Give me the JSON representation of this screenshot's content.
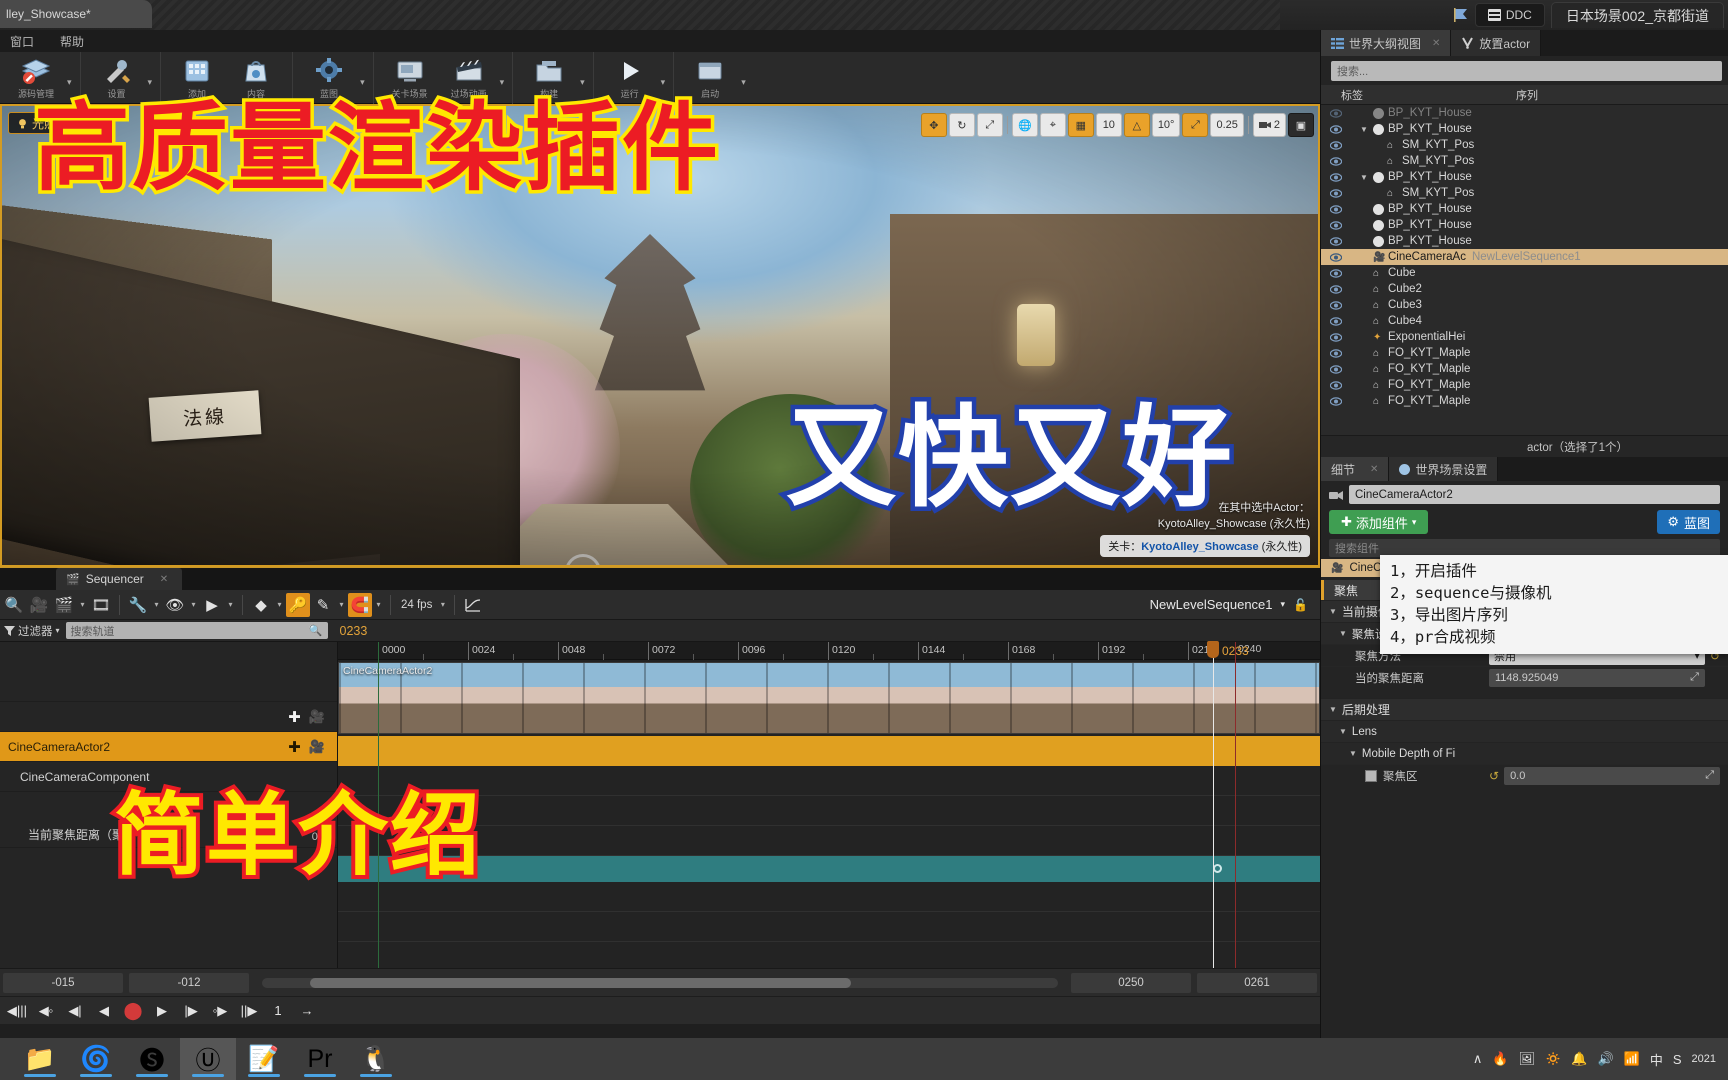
{
  "titlebar": {
    "project_tab": "lley_Showcase*",
    "ddc_label": "DDC",
    "scene_tab": "日本场景002_京都街道"
  },
  "menubar": {
    "items": [
      "窗口",
      "帮助"
    ]
  },
  "toolbar": {
    "items": [
      {
        "label": "源码管理",
        "icon": "source-control-icon",
        "glyph": "📚",
        "caret": true
      },
      {
        "label": "设置",
        "icon": "settings-wrench-icon",
        "glyph": "🛠",
        "caret": true
      },
      {
        "label": "添加",
        "icon": "add-content-icon",
        "glyph": "🗂",
        "caret": false
      },
      {
        "label": "内容",
        "icon": "content-browser-icon",
        "glyph": "🛍",
        "caret": false
      },
      {
        "label": "蓝图",
        "icon": "blueprint-icon",
        "glyph": "🎛",
        "caret": true
      },
      {
        "label": "关卡场景",
        "icon": "cinematics-icon",
        "glyph": "🖥",
        "caret": false
      },
      {
        "label": "过场动画",
        "icon": "sequencer-clapper-icon",
        "glyph": "🎬",
        "caret": true
      },
      {
        "label": "构建",
        "icon": "build-icon",
        "glyph": "📁",
        "caret": true
      },
      {
        "label": "运行",
        "icon": "play-icon",
        "glyph": "▶",
        "caret": true
      },
      {
        "label": "启动",
        "icon": "launch-icon",
        "glyph": "🗔",
        "caret": true
      }
    ]
  },
  "viewport": {
    "realtime_badge": "光照",
    "sign_text": "法線",
    "sign2_text": "法線",
    "toolbar": [
      {
        "name": "select-mode",
        "label": "✥",
        "state": "selected"
      },
      {
        "name": "rotate-mode",
        "label": "↻",
        "state": "normal"
      },
      {
        "name": "scale-mode",
        "label": "⤢",
        "state": "normal"
      },
      {
        "name": "world-space",
        "label": "🌐",
        "state": "normal"
      },
      {
        "name": "surface-snap",
        "label": "⌖",
        "state": "normal"
      },
      {
        "name": "grid-snap",
        "label": "▦",
        "state": "selected"
      },
      {
        "name": "grid-size",
        "label": "10",
        "state": "normal"
      },
      {
        "name": "angle-snap",
        "label": "△",
        "state": "selected"
      },
      {
        "name": "angle-size",
        "label": "10°",
        "state": "normal"
      },
      {
        "name": "scale-snap",
        "label": "⤢",
        "state": "selected"
      },
      {
        "name": "scale-size",
        "label": "0.25",
        "state": "normal"
      },
      {
        "name": "camera-speed",
        "label": "2",
        "state": "normal"
      },
      {
        "name": "maximize-viewport",
        "label": "▣",
        "state": "dark"
      }
    ],
    "callout_line1": "在其中选中Actor：",
    "callout_line2": "KyotoAlley_Showcase (永久性)",
    "level_prefix": "关卡：",
    "level_name": "KyotoAlley_Showcase",
    "level_suffix": " (永久性)"
  },
  "outliner": {
    "tabs": [
      {
        "label": "世界大纲视图",
        "icon": "outliner-icon",
        "active": true,
        "closable": true
      },
      {
        "label": "放置actor",
        "icon": "place-actor-icon",
        "active": false,
        "closable": false
      }
    ],
    "search_placeholder": "搜索...",
    "col_label": "标签",
    "col_type": "序列",
    "rows": [
      {
        "name": "BP_KYT_House",
        "indent": 1,
        "icon": "sphere",
        "expand": "",
        "cut": true
      },
      {
        "name": "BP_KYT_House",
        "indent": 1,
        "icon": "sphere",
        "expand": "▼"
      },
      {
        "name": "SM_KYT_Pos",
        "indent": 2,
        "icon": "mesh",
        "expand": ""
      },
      {
        "name": "SM_KYT_Pos",
        "indent": 2,
        "icon": "mesh",
        "expand": ""
      },
      {
        "name": "BP_KYT_House",
        "indent": 1,
        "icon": "sphere",
        "expand": "▼"
      },
      {
        "name": "SM_KYT_Pos",
        "indent": 2,
        "icon": "mesh",
        "expand": ""
      },
      {
        "name": "BP_KYT_House",
        "indent": 1,
        "icon": "sphere",
        "expand": ""
      },
      {
        "name": "BP_KYT_House",
        "indent": 1,
        "icon": "sphere",
        "expand": ""
      },
      {
        "name": "BP_KYT_House",
        "indent": 1,
        "icon": "sphere",
        "expand": ""
      },
      {
        "name": "CineCameraAc",
        "seq": "NewLevelSequence1",
        "indent": 1,
        "icon": "camera",
        "expand": "",
        "selected": true
      },
      {
        "name": "Cube",
        "indent": 1,
        "icon": "mesh",
        "expand": ""
      },
      {
        "name": "Cube2",
        "indent": 1,
        "icon": "mesh",
        "expand": ""
      },
      {
        "name": "Cube3",
        "indent": 1,
        "icon": "mesh",
        "expand": ""
      },
      {
        "name": "Cube4",
        "indent": 1,
        "icon": "mesh",
        "expand": ""
      },
      {
        "name": "ExponentialHei",
        "indent": 1,
        "icon": "fog",
        "expand": ""
      },
      {
        "name": "FO_KYT_Maple",
        "indent": 1,
        "icon": "mesh",
        "expand": ""
      },
      {
        "name": "FO_KYT_Maple",
        "indent": 1,
        "icon": "mesh",
        "expand": ""
      },
      {
        "name": "FO_KYT_Maple",
        "indent": 1,
        "icon": "mesh",
        "expand": ""
      },
      {
        "name": "FO_KYT_Maple",
        "indent": 1,
        "icon": "mesh",
        "expand": ""
      }
    ],
    "status": "actor（选择了1个）"
  },
  "details": {
    "tabs": [
      {
        "label": "细节",
        "active": true,
        "closable": true
      },
      {
        "label": "世界场景设置",
        "icon": "world-settings-icon",
        "active": false
      }
    ],
    "actor_name": "CineCameraActor2",
    "add_component_label": "添加组件",
    "blueprint_label": "蓝图",
    "component_search_placeholder": "搜索组件",
    "component_item": "CineCameraActor2",
    "section_tab": "聚焦",
    "groups": [
      {
        "label": "当前摄像机设置",
        "level": 0
      },
      {
        "label": "聚焦设置",
        "level": 1
      }
    ],
    "rows": [
      {
        "label": "聚焦方法",
        "type": "combo",
        "value": "禁用",
        "reset": true
      },
      {
        "label": "当的聚焦距离",
        "type": "num",
        "value": "1148.925049"
      }
    ],
    "post_process": "后期处理",
    "lens": "Lens",
    "mobile_dof": "Mobile Depth of Fi",
    "focus_area_label": "聚焦区",
    "focus_area_value": "0.0"
  },
  "steps_overlay": {
    "lines": [
      "1，开启插件",
      "2，sequence与摄像机",
      "3，导出图片序列",
      "4，pr合成视频"
    ]
  },
  "sequencer": {
    "tab_label": "Sequencer",
    "toolbar": [
      {
        "name": "search-icon",
        "glyph": "🔍",
        "state": "off",
        "caret": false
      },
      {
        "name": "create-camera-icon",
        "glyph": "🎥",
        "state": "off",
        "caret": false
      },
      {
        "name": "actions-clapper-icon",
        "glyph": "🎬",
        "state": "off",
        "caret": true
      },
      {
        "name": "render-movie-icon",
        "glyph": "🎞",
        "state": "off",
        "caret": false
      },
      {
        "name": "settings-wrench-icon",
        "glyph": "🔧",
        "state": "off",
        "caret": true
      },
      {
        "name": "view-options-icon",
        "glyph": "👁",
        "state": "off",
        "caret": true
      },
      {
        "name": "playback-options-icon",
        "glyph": "▶",
        "state": "off",
        "caret": true
      },
      {
        "name": "keyframe-icon",
        "glyph": "◆",
        "state": "off",
        "caret": true
      },
      {
        "name": "auto-key-icon",
        "glyph": "🔑",
        "state": "on",
        "caret": false
      },
      {
        "name": "curve-edit-icon",
        "glyph": "✎",
        "state": "off",
        "caret": true
      },
      {
        "name": "snap-magnet-icon",
        "glyph": "🧲",
        "state": "on",
        "caret": true
      }
    ],
    "fps_label": "24 fps",
    "curve_icon": "curve-editor-icon",
    "sequence_name": "NewLevelSequence1",
    "lock_icon": "lock-icon",
    "filter_label": "过滤器",
    "track_search_placeholder": "搜索轨道",
    "current_frame": "0233",
    "ruler_ticks": [
      "0000",
      "0024",
      "0048",
      "0072",
      "0096",
      "0120",
      "0144",
      "0168",
      "0192",
      "0216"
    ],
    "end_frame": "0240",
    "playhead_frame": "0233",
    "film_track_label": "CineCameraActor2",
    "tracks": [
      {
        "label": "",
        "type": "blank"
      },
      {
        "label": "CineCameraActor2",
        "type": "camera"
      },
      {
        "label": "CineCameraComponent",
        "type": "prop"
      },
      {
        "label": "当前聚焦距离（聚焦设置）",
        "type": "prop",
        "value": "0.0"
      }
    ],
    "timecode_in": "-015",
    "timecode_out": "-012",
    "timecode_start": "0250",
    "timecode_end": "0261",
    "transport": [
      {
        "name": "jump-to-start-button",
        "glyph": "◀|||"
      },
      {
        "name": "previous-key-button",
        "glyph": "◀◦"
      },
      {
        "name": "step-back-button",
        "glyph": "◀|"
      },
      {
        "name": "play-reverse-button",
        "glyph": "◀"
      },
      {
        "name": "record-button",
        "glyph": "⬤"
      },
      {
        "name": "play-button",
        "glyph": "▶"
      },
      {
        "name": "step-forward-button",
        "glyph": "|▶"
      },
      {
        "name": "next-key-button",
        "glyph": "◦▶"
      },
      {
        "name": "jump-to-end-button",
        "glyph": "||▶"
      },
      {
        "name": "loop-button",
        "glyph": "1"
      },
      {
        "name": "playback-range-button",
        "glyph": "→"
      }
    ]
  },
  "captions": {
    "headline": "高质量渲染插件",
    "subline": "又快又好",
    "footline": "简单介绍"
  },
  "taskbar": {
    "items": [
      {
        "name": "file-explorer-icon",
        "glyph": "📁",
        "active": false
      },
      {
        "name": "blender-icon",
        "glyph": "🌀",
        "active": false
      },
      {
        "name": "substance-icon",
        "glyph": "🅢",
        "active": false
      },
      {
        "name": "unreal-engine-icon",
        "glyph": "Ⓤ",
        "active": true
      },
      {
        "name": "notepad-icon",
        "glyph": "📝",
        "active": false
      },
      {
        "name": "premiere-pro-icon",
        "glyph": "Pr",
        "active": false
      },
      {
        "name": "qq-icon",
        "glyph": "🐧",
        "active": false
      }
    ],
    "tray": [
      "∧",
      "🔥",
      "🖼",
      "🔅",
      "🔔",
      "🔊",
      "📶",
      "中",
      "S"
    ],
    "clock": "2021"
  },
  "colors": {
    "accent_orange": "#e0a020",
    "selection_tan": "#d8b684",
    "green_button": "#3f9e52",
    "blue_button": "#1f6fb8",
    "caption_red": "#ec1c24",
    "caption_yellow": "#ffe800",
    "caption_blue": "#2240ab",
    "teal_track": "#2f7d80"
  }
}
